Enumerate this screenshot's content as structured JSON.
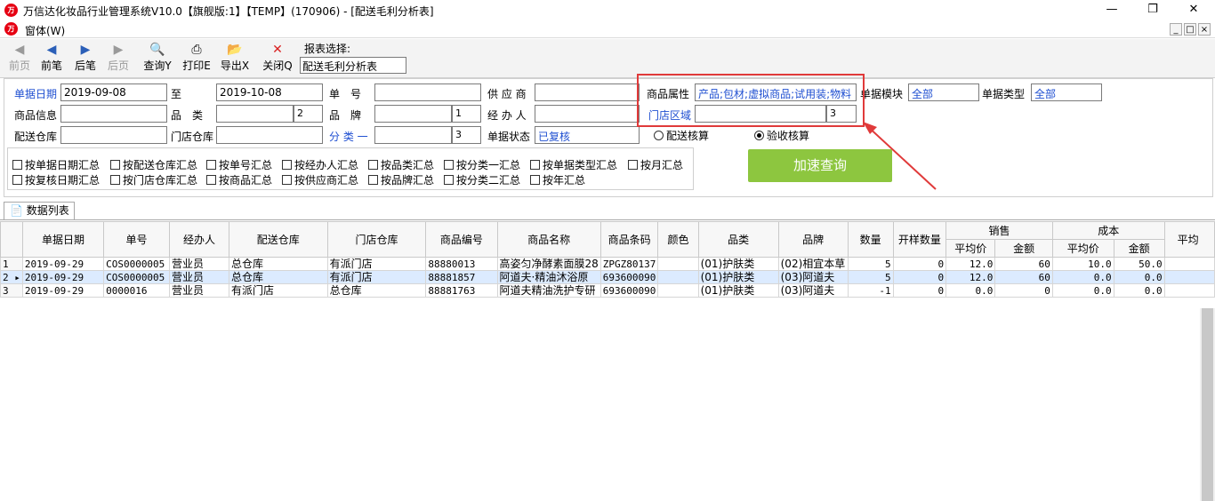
{
  "window": {
    "title": "万信达化妆品行业管理系统V10.0【旗舰版:1】【TEMP】(170906) - [配送毛利分析表]",
    "menu": "窗体(W)"
  },
  "toolbar": {
    "first": "前页",
    "prev": "前笔",
    "next": "后笔",
    "last": "后页",
    "query": "查询Y",
    "print": "打印E",
    "export": "导出X",
    "close": "关闭Q",
    "report_select_label": "报表选择:",
    "report_select_value": "配送毛利分析表"
  },
  "filters": {
    "date_label": "单据日期",
    "date_from": "2019-09-08",
    "to_label": "至",
    "date_to": "2019-10-08",
    "docno_label": "单　号",
    "supplier_label": "供 应 商",
    "attr_label": "商品属性",
    "attr_value": "产品;包材;虚拟商品;试用装;物料",
    "module_label": "单据模块",
    "module_value": "全部",
    "doctype_label": "单据类型",
    "doctype_value": "全部",
    "goods_label": "商品信息",
    "category_label": "品　类",
    "category_level": "2",
    "brand_label": "品　牌",
    "brand_level": "1",
    "handler_label": "经 办 人",
    "store_area_label": "门店区域",
    "store_area_level": "3",
    "warehouse_label": "配送仓库",
    "store_wh_label": "门店仓库",
    "class1_label": "分 类 一",
    "class1_level": "3",
    "status_label": "单据状态",
    "status_value": "已复核",
    "radio_delivery": "配送核算",
    "radio_receive": "验收核算",
    "fast_query": "加速查询"
  },
  "group_by": {
    "row1": [
      "按单据日期汇总",
      "按配送仓库汇总",
      "按单号汇总",
      "按经办人汇总",
      "按品类汇总",
      "按分类一汇总",
      "按单据类型汇总",
      "按月汇总"
    ],
    "row2": [
      "按复核日期汇总",
      "按门店仓库汇总",
      "按商品汇总",
      "按供应商汇总",
      "按品牌汇总",
      "按分类二汇总",
      "按年汇总"
    ]
  },
  "tab": "数据列表",
  "grid": {
    "headers": [
      "单据日期",
      "单号",
      "经办人",
      "配送仓库",
      "门店仓库",
      "商品编号",
      "商品名称",
      "商品条码",
      "颜色",
      "品类",
      "品牌",
      "数量",
      "开样数量"
    ],
    "group_sales": "销售",
    "group_cost": "成本",
    "sub_avg": "平均价",
    "sub_amount": "金额",
    "last_partial": "平均",
    "rows": [
      {
        "no": "1",
        "date": "2019-09-29",
        "docno": "COS0000005",
        "handler": "营业员",
        "wh": "总仓库",
        "store": "有派门店",
        "code": "88880013",
        "name": "高姿匀净酵素面膜28",
        "barcode": "ZPGZ80137",
        "color": "",
        "cat": "(01)护肤类",
        "brand": "(02)相宜本草",
        "qty": "5",
        "sample": "0",
        "s_avg": "12.0",
        "s_amt": "60",
        "c_avg": "10.0",
        "c_amt": "50.0"
      },
      {
        "no": "2",
        "date": "2019-09-29",
        "docno": "COS0000005",
        "handler": "营业员",
        "wh": "总仓库",
        "store": "有派门店",
        "code": "88881857",
        "name": "阿道夫·精油沐浴原",
        "barcode": "693600090",
        "color": "",
        "cat": "(01)护肤类",
        "brand": "(03)阿道夫",
        "qty": "5",
        "sample": "0",
        "s_avg": "12.0",
        "s_amt": "60",
        "c_avg": "0.0",
        "c_amt": "0.0"
      },
      {
        "no": "3",
        "date": "2019-09-29",
        "docno": "0000016",
        "handler": "营业员",
        "wh": "有派门店",
        "store": "总仓库",
        "code": "88881763",
        "name": "阿道夫精油洗护专研",
        "barcode": "693600090",
        "color": "",
        "cat": "(01)护肤类",
        "brand": "(03)阿道夫",
        "qty": "-1",
        "sample": "0",
        "s_avg": "0.0",
        "s_amt": "0",
        "c_avg": "0.0",
        "c_amt": "0.0"
      }
    ]
  },
  "colors": {
    "accent": "#1f4fd1",
    "highlight": "#e03a3a",
    "fast_button": "#8dc63f"
  }
}
